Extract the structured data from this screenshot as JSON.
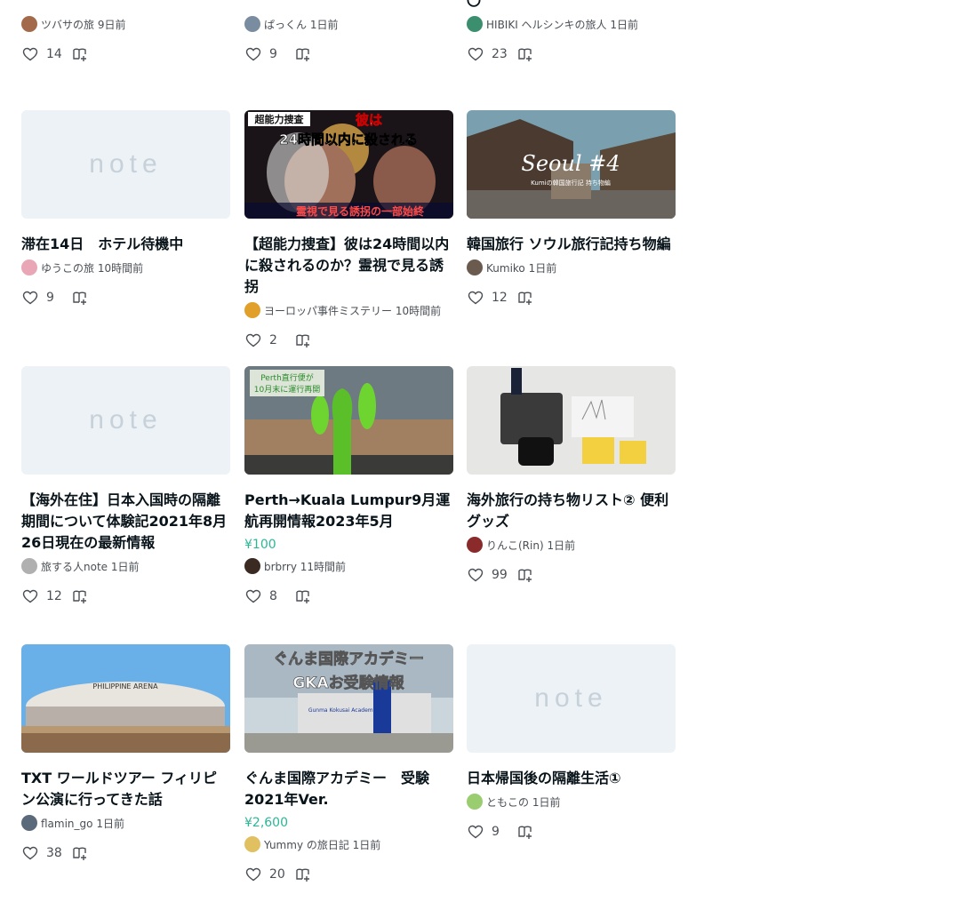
{
  "cards": [
    {
      "title": "",
      "price": "",
      "author": "ツバサの旅 9日前",
      "likes": "14",
      "thumb": "none",
      "avatar": "#a26a4a"
    },
    {
      "title": "",
      "price": "",
      "author": "ぱっくん 1日前",
      "likes": "9",
      "thumb": "none",
      "avatar": "#7a8ca0"
    },
    {
      "title": "〇",
      "price": "",
      "author": "HIBIKI ヘルシンキの旅人 1日前",
      "likes": "23",
      "thumb": "none",
      "avatar": "#3b8f6e"
    },
    {
      "title": "滞在14日　ホテル待機中",
      "price": "",
      "author": "ゆうこの旅 10時間前",
      "likes": "9",
      "thumb": "note",
      "avatar": "#e9a6b6"
    },
    {
      "title": "【超能力捜査】彼は24時間以内に殺されるのか？霊視で見る誘拐",
      "price": "",
      "author": "ヨーロッパ事件ミステリー 10時間前",
      "likes": "2",
      "thumb": "psychic",
      "avatar": "#e1a02a"
    },
    {
      "title": "韓国旅行 ソウル旅行記持ち物編",
      "price": "",
      "author": "Kumiko 1日前",
      "likes": "12",
      "thumb": "seoul",
      "avatar": "#6b5a4e"
    },
    {
      "title": "【海外在住】日本入国時の隔離期間について体験記2021年8月26日現在の最新情報",
      "price": "",
      "author": "旅する人note 1日前",
      "likes": "12",
      "thumb": "note",
      "avatar": "#b0b0b0"
    },
    {
      "title": "Perth→Kuala Lumpur9月運航再開情報2023年5月",
      "price": "¥100",
      "author": "brbrry 11時間前",
      "likes": "8",
      "thumb": "perth",
      "avatar": "#3a2a22"
    },
    {
      "title": "海外旅行の持ち物リスト② 便利グッズ",
      "price": "",
      "author": "りんこ(Rin) 1日前",
      "likes": "99",
      "thumb": "items",
      "avatar": "#8a2a2a"
    },
    {
      "title": "TXT ワールドツアー フィリピン公演に行ってきた話",
      "price": "",
      "author": "flamin_go 1日前",
      "likes": "38",
      "thumb": "arena",
      "avatar": "#5a6a7a"
    },
    {
      "title": "ぐんま国際アカデミー　受験　2021年Ver.",
      "price": "¥2,600",
      "author": "Yummy の旅日記 1日前",
      "likes": "20",
      "thumb": "gka",
      "avatar": "#e0c060"
    },
    {
      "title": "日本帰国後の隔離生活①",
      "price": "",
      "author": "ともこの 1日前",
      "likes": "9",
      "thumb": "note",
      "avatar": "#9acd70"
    }
  ],
  "thumb_text": {
    "note_logo": "note",
    "psychic_tag": "超能力捜査",
    "psychic_line1": "彼は",
    "psychic_line2": "24時間以内に殺される",
    "psychic_bottom": "霊視で見る誘拐の一部始終",
    "seoul_title": "Seoul #4",
    "seoul_sub": "Kumiの韓国旅行記 持ち物編",
    "perth_sign1": "Perth直行便が",
    "perth_sign2": "10月末に運行再開",
    "arena_sign": "PHILIPPINE ARENA",
    "gka_line1": "ぐんま国際アカデミー",
    "gka_line2": "GKAお受験情報",
    "gka_sign": "Gunma Kokusai Academy"
  },
  "colors": {
    "accent": "#2cb696",
    "text": "#08131a",
    "muted": "#4a4f55",
    "placeholder_bg": "#edf2f6",
    "placeholder_logo": "#c7d1d9"
  },
  "icons": {
    "like": "heart-icon",
    "magazine": "add-to-magazine-icon"
  }
}
